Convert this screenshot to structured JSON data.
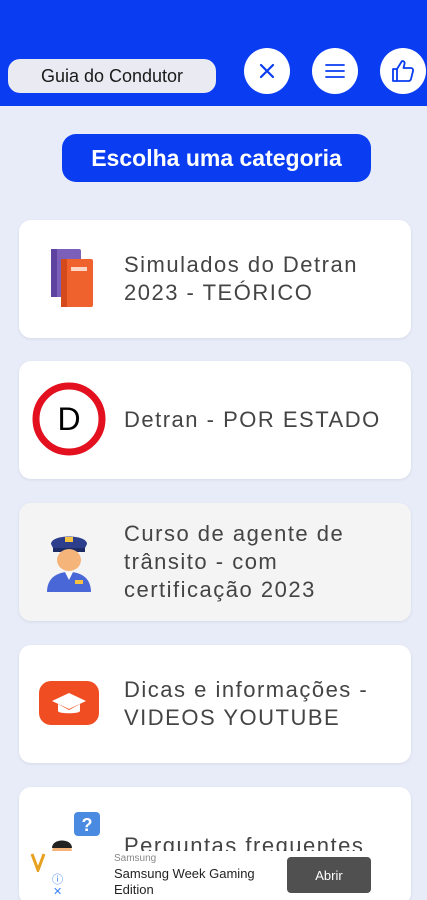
{
  "header": {
    "app_title": "Guia do Condutor",
    "buttons": {
      "close_icon": "close-icon",
      "menu_icon": "menu-icon",
      "like_icon": "thumbs-up-icon"
    },
    "color": "#0a3cf2"
  },
  "category_title": "Escolha uma categoria",
  "cards": [
    {
      "label": "Simulados do Detran 2023 - TEÓRICO",
      "icon": "books-icon"
    },
    {
      "label": "Detran -  POR ESTADO",
      "icon": "detran-d-sign-icon",
      "icon_letter": "D"
    },
    {
      "label": "Curso de agente de trânsito - com certificação 2023",
      "icon": "traffic-officer-icon"
    },
    {
      "label": "Dicas e informações - VIDEOS YOUTUBE",
      "icon": "youtube-graduation-icon"
    },
    {
      "label": "Perguntas frequentes",
      "icon": "question-person-icon"
    }
  ],
  "ad": {
    "brand": "Samsung",
    "text": "Samsung Week Gaming Edition",
    "button": "Abrir",
    "info_icon": "info-icon",
    "close_icon": "close-x-icon"
  }
}
